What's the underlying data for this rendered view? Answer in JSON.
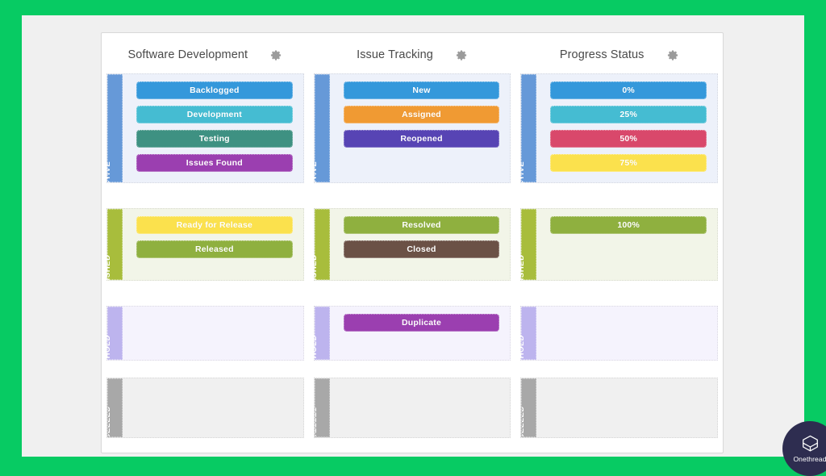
{
  "brand": {
    "name": "Onethread",
    "logo_icon": "cube-box-icon",
    "circle_color": "#2E2D50"
  },
  "theme": {
    "page_border": "#07CB63",
    "page_background": "#F0F0F0",
    "card_background": "#FFFFFF"
  },
  "board": {
    "columns": [
      {
        "title": "Software Development",
        "settings_icon": "gear-icon",
        "lanes": [
          {
            "label": "ACTIVE",
            "label_color": "#6699D8",
            "background": "#EDF1FA",
            "chips": [
              {
                "label": "Backlogged",
                "color": "#3498DB"
              },
              {
                "label": "Development",
                "color": "#45BCD2"
              },
              {
                "label": "Testing",
                "color": "#3E9182"
              },
              {
                "label": "Issues Found",
                "color": "#9B3FB0"
              }
            ]
          },
          {
            "label": "FINISHED",
            "label_color": "#A8BD3C",
            "background": "#F2F5E8",
            "chips": [
              {
                "label": "Ready for Release",
                "color": "#FBE14D"
              },
              {
                "label": "Released",
                "color": "#8FB03F"
              }
            ]
          },
          {
            "label": "ON HOLD",
            "label_color": "#BDB4EE",
            "background": "#F5F3FD",
            "chips": []
          },
          {
            "label": "CANCELLED",
            "label_color": "#A8A8A8",
            "background": "#F0F0F0",
            "chips": []
          }
        ]
      },
      {
        "title": "Issue Tracking",
        "settings_icon": "gear-icon",
        "lanes": [
          {
            "label": "ACTIVE",
            "label_color": "#6699D8",
            "background": "#EDF1FA",
            "chips": [
              {
                "label": "New",
                "color": "#3498DB"
              },
              {
                "label": "Assigned",
                "color": "#F09A33"
              },
              {
                "label": "Reopened",
                "color": "#5744B4"
              }
            ]
          },
          {
            "label": "FINISHED",
            "label_color": "#A8BD3C",
            "background": "#F2F5E8",
            "chips": [
              {
                "label": "Resolved",
                "color": "#8FB03F"
              },
              {
                "label": "Closed",
                "color": "#6B5146"
              }
            ]
          },
          {
            "label": "ON HOLD",
            "label_color": "#BDB4EE",
            "background": "#F5F3FD",
            "chips": [
              {
                "label": "Duplicate",
                "color": "#9B3FB0"
              }
            ]
          },
          {
            "label": "CANCELLED",
            "label_color": "#A8A8A8",
            "background": "#F0F0F0",
            "chips": []
          }
        ]
      },
      {
        "title": "Progress Status",
        "settings_icon": "gear-icon",
        "lanes": [
          {
            "label": "ACTIVE",
            "label_color": "#6699D8",
            "background": "#EDF1FA",
            "chips": [
              {
                "label": "0%",
                "color": "#3498DB"
              },
              {
                "label": "25%",
                "color": "#45BCD2"
              },
              {
                "label": "50%",
                "color": "#D9486B"
              },
              {
                "label": "75%",
                "color": "#FBE14D"
              }
            ]
          },
          {
            "label": "FINISHED",
            "label_color": "#A8BD3C",
            "background": "#F2F5E8",
            "chips": [
              {
                "label": "100%",
                "color": "#8FB03F"
              }
            ]
          },
          {
            "label": "ON HOLD",
            "label_color": "#BDB4EE",
            "background": "#F5F3FD",
            "chips": []
          },
          {
            "label": "CANCELLED",
            "label_color": "#A8A8A8",
            "background": "#F0F0F0",
            "chips": []
          }
        ]
      }
    ]
  }
}
